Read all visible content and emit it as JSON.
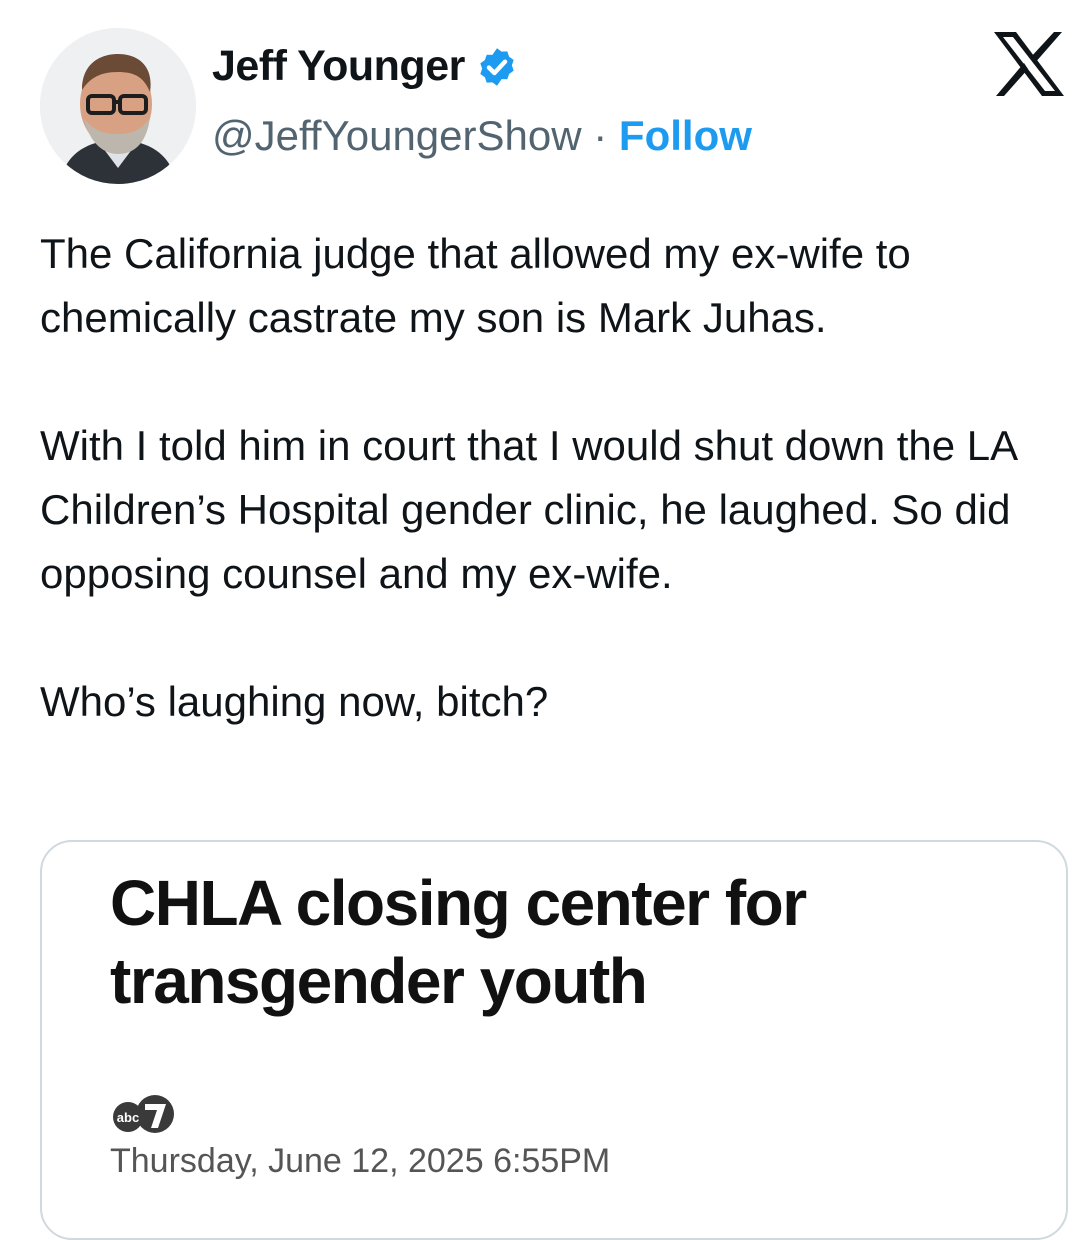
{
  "author": {
    "name": "Jeff Younger",
    "handle": "@JeffYoungerShow",
    "separator": "·",
    "follow_label": "Follow",
    "verified_icon": "verified-badge-icon",
    "verified_color": "#1d9bf0"
  },
  "platform_icon": "x-logo-icon",
  "tweet": {
    "paragraphs": [
      "The California judge that allowed my ex-wife to chemically castrate my son is Mark Juhas.",
      "With I told him in court that I would shut down the LA Children’s Hospital gender clinic, he laughed. So did opposing counsel and my ex-wife.",
      "Who’s laughing now, bitch?"
    ]
  },
  "card": {
    "headline": "CHLA closing center for transgender youth",
    "source_icon": "abc7-logo-icon",
    "date": "Thursday, June 12, 2025 6:55PM"
  },
  "colors": {
    "text": "#0f1419",
    "secondary": "#536471",
    "link": "#1d9bf0",
    "border": "#cfd9de"
  }
}
